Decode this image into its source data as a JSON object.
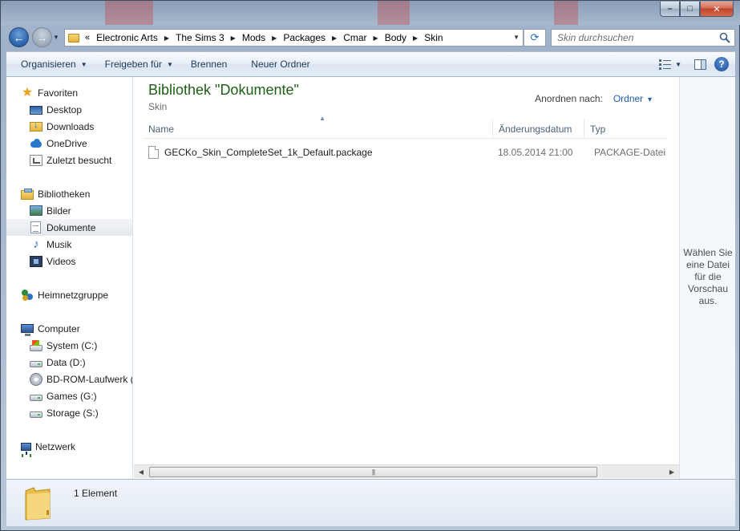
{
  "window": {
    "caption_buttons": [
      "minimize",
      "maximize",
      "close"
    ]
  },
  "nav": {
    "back_icon": "back-arrow-icon",
    "forward_icon": "forward-arrow-icon"
  },
  "address": {
    "overflow": "«",
    "breadcrumbs": [
      "Electronic Arts",
      "The Sims 3",
      "Mods",
      "Packages",
      "Cmar",
      "Body",
      "Skin"
    ],
    "search_placeholder": "Skin durchsuchen"
  },
  "toolbar": {
    "organize": "Organisieren",
    "share": "Freigeben für",
    "burn": "Brennen",
    "new_folder": "Neuer Ordner"
  },
  "sidebar": {
    "favorites": {
      "label": "Favoriten",
      "items": [
        "Desktop",
        "Downloads",
        "OneDrive",
        "Zuletzt besucht"
      ]
    },
    "libraries": {
      "label": "Bibliotheken",
      "items": [
        "Bilder",
        "Dokumente",
        "Musik",
        "Videos"
      ],
      "selected": "Dokumente"
    },
    "homegroup": "Heimnetzgruppe",
    "computer": {
      "label": "Computer",
      "items": [
        "System (C:)",
        "Data (D:)",
        "BD-ROM-Laufwerk (",
        "Games (G:)",
        "Storage (S:)"
      ]
    },
    "network": "Netzwerk"
  },
  "library": {
    "title": "Bibliothek \"Dokumente\"",
    "subtitle": "Skin",
    "arrange_label": "Anordnen nach:",
    "arrange_value": "Ordner"
  },
  "columns": {
    "name": "Name",
    "date": "Änderungsdatum",
    "type": "Typ"
  },
  "files": [
    {
      "name": "GECKo_Skin_CompleteSet_1k_Default.package",
      "date": "18.05.2014 21:00",
      "type": "PACKAGE-Datei"
    }
  ],
  "preview": {
    "text": "Wählen Sie eine Datei für die Vorschau aus."
  },
  "details": {
    "count": "1 Element"
  },
  "colors": {
    "library_title": "#1e5f16",
    "link_blue": "#1e5ca8",
    "toolbar_text": "#1e395b"
  }
}
